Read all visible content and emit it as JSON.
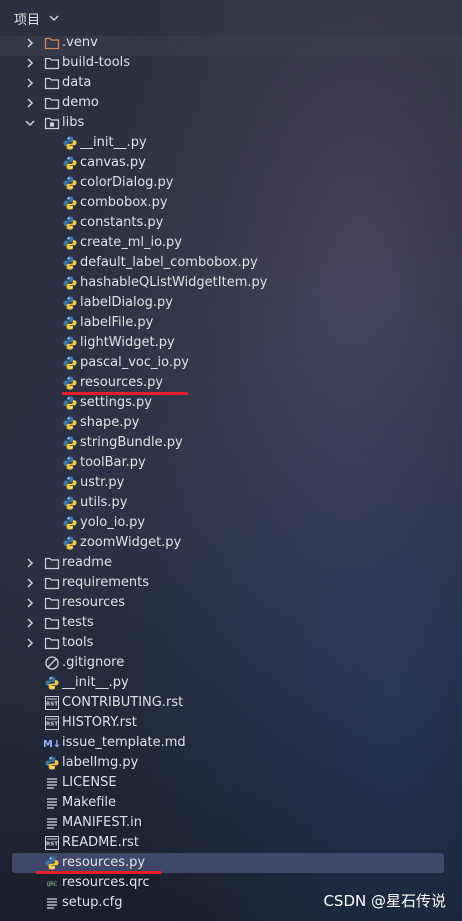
{
  "header": {
    "title": "项目"
  },
  "tree": [
    {
      "label": ".venv",
      "type": "folder-orange",
      "level": 1,
      "arrow": "right"
    },
    {
      "label": "build-tools",
      "type": "folder",
      "level": 1,
      "arrow": "right"
    },
    {
      "label": "data",
      "type": "folder",
      "level": 1,
      "arrow": "right"
    },
    {
      "label": "demo",
      "type": "folder",
      "level": 1,
      "arrow": "right"
    },
    {
      "label": "libs",
      "type": "folder-package",
      "level": 1,
      "arrow": "down"
    },
    {
      "label": "__init__.py",
      "type": "python",
      "level": 2
    },
    {
      "label": "canvas.py",
      "type": "python",
      "level": 2
    },
    {
      "label": "colorDialog.py",
      "type": "python",
      "level": 2
    },
    {
      "label": "combobox.py",
      "type": "python",
      "level": 2
    },
    {
      "label": "constants.py",
      "type": "python",
      "level": 2
    },
    {
      "label": "create_ml_io.py",
      "type": "python",
      "level": 2
    },
    {
      "label": "default_label_combobox.py",
      "type": "python",
      "level": 2
    },
    {
      "label": "hashableQListWidgetItem.py",
      "type": "python",
      "level": 2
    },
    {
      "label": "labelDialog.py",
      "type": "python",
      "level": 2
    },
    {
      "label": "labelFile.py",
      "type": "python",
      "level": 2
    },
    {
      "label": "lightWidget.py",
      "type": "python",
      "level": 2
    },
    {
      "label": "pascal_voc_io.py",
      "type": "python",
      "level": 2
    },
    {
      "label": "resources.py",
      "type": "python",
      "level": 2,
      "underline": true
    },
    {
      "label": "settings.py",
      "type": "python",
      "level": 2
    },
    {
      "label": "shape.py",
      "type": "python",
      "level": 2
    },
    {
      "label": "stringBundle.py",
      "type": "python",
      "level": 2
    },
    {
      "label": "toolBar.py",
      "type": "python",
      "level": 2
    },
    {
      "label": "ustr.py",
      "type": "python",
      "level": 2
    },
    {
      "label": "utils.py",
      "type": "python",
      "level": 2
    },
    {
      "label": "yolo_io.py",
      "type": "python",
      "level": 2
    },
    {
      "label": "zoomWidget.py",
      "type": "python",
      "level": 2
    },
    {
      "label": "readme",
      "type": "folder",
      "level": 1,
      "arrow": "right"
    },
    {
      "label": "requirements",
      "type": "folder",
      "level": 1,
      "arrow": "right"
    },
    {
      "label": "resources",
      "type": "folder",
      "level": 1,
      "arrow": "right"
    },
    {
      "label": "tests",
      "type": "folder",
      "level": 1,
      "arrow": "right"
    },
    {
      "label": "tools",
      "type": "folder",
      "level": 1,
      "arrow": "right"
    },
    {
      "label": ".gitignore",
      "type": "gitignore",
      "level": 1
    },
    {
      "label": "__init__.py",
      "type": "python",
      "level": 1
    },
    {
      "label": "CONTRIBUTING.rst",
      "type": "rst",
      "level": 1
    },
    {
      "label": "HISTORY.rst",
      "type": "rst",
      "level": 1
    },
    {
      "label": "issue_template.md",
      "type": "markdown",
      "level": 1
    },
    {
      "label": "labelImg.py",
      "type": "python",
      "level": 1
    },
    {
      "label": "LICENSE",
      "type": "text",
      "level": 1
    },
    {
      "label": "Makefile",
      "type": "text",
      "level": 1
    },
    {
      "label": "MANIFEST.in",
      "type": "text",
      "level": 1
    },
    {
      "label": "README.rst",
      "type": "rst",
      "level": 1
    },
    {
      "label": "resources.py",
      "type": "python",
      "level": 1,
      "selected": true,
      "underline": true
    },
    {
      "label": "resources.qrc",
      "type": "qrc",
      "level": 1
    },
    {
      "label": "setup.cfg",
      "type": "text",
      "level": 1
    }
  ],
  "icon_text": {
    "rst": "RST",
    "markdown": "M↓",
    "qrc": "QRC"
  },
  "watermark": "CSDN @星石传说",
  "colors": {
    "selection": "#4b557d",
    "underline": "#e5202a",
    "python_blue": "#3b78b0",
    "python_yellow": "#f3c93a",
    "folder_outline": "#cfd3da",
    "venv_folder": "#d98b4a"
  }
}
